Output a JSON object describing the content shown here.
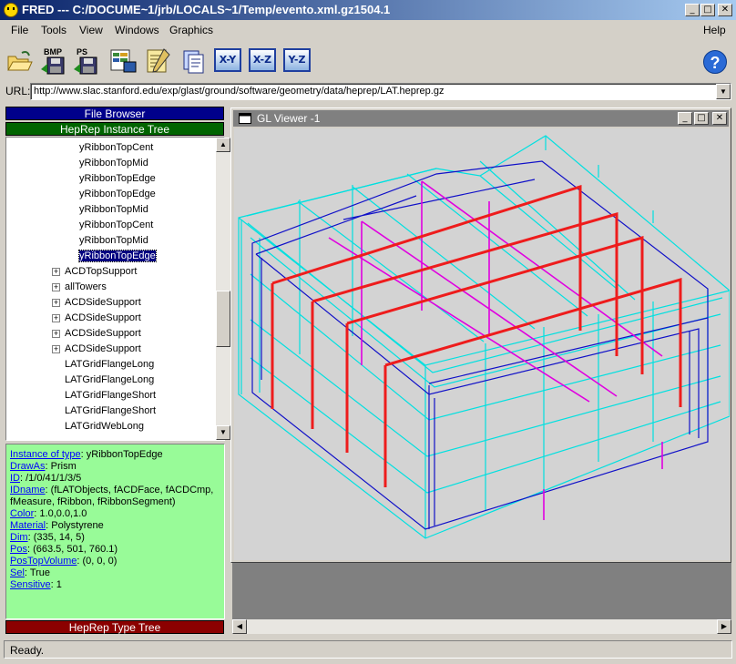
{
  "window": {
    "title": "FRED --- C:/DOCUME~1/jrb/LOCALS~1/Temp/evento.xml.gz1504.1"
  },
  "menu": {
    "file": "File",
    "tools": "Tools",
    "view": "View",
    "windows": "Windows",
    "graphics": "Graphics",
    "help": "Help"
  },
  "toolbar": {
    "bmp_label": "BMP",
    "ps_label": "PS",
    "xy_label": "X-Y",
    "xz_label": "X-Z",
    "yz_label": "Y-Z",
    "help_glyph": "?"
  },
  "url": {
    "label": "URL:",
    "value": "http://www.slac.stanford.edu/exp/glast/ground/software/geometry/data/heprep/LAT.heprep.gz"
  },
  "left": {
    "file_browser": "File Browser",
    "instance_tree": "HepRep Instance Tree",
    "type_tree": "HepRep Type Tree"
  },
  "tree": {
    "items": [
      {
        "label": "yRibbonTopCent"
      },
      {
        "label": "yRibbonTopMid"
      },
      {
        "label": "yRibbonTopEdge"
      },
      {
        "label": "yRibbonTopEdge"
      },
      {
        "label": "yRibbonTopMid"
      },
      {
        "label": "yRibbonTopCent"
      },
      {
        "label": "yRibbonTopMid"
      },
      {
        "label": "yRibbonTopEdge",
        "selected": true
      },
      {
        "label": "ACDTopSupport",
        "expandable": true
      },
      {
        "label": "allTowers",
        "expandable": true
      },
      {
        "label": "ACDSideSupport",
        "expandable": true
      },
      {
        "label": "ACDSideSupport",
        "expandable": true
      },
      {
        "label": "ACDSideSupport",
        "expandable": true
      },
      {
        "label": "ACDSideSupport",
        "expandable": true
      },
      {
        "label": "LATGridFlangeLong"
      },
      {
        "label": "LATGridFlangeLong"
      },
      {
        "label": "LATGridFlangeShort"
      },
      {
        "label": "LATGridFlangeShort"
      },
      {
        "label": "LATGridWebLong"
      }
    ]
  },
  "info": {
    "instance_key": "Instance of type",
    "instance_val": "yRibbonTopEdge",
    "drawas_key": "DrawAs",
    "drawas_val": "Prism",
    "id_key": "ID",
    "id_val": "/1/0/41/1/3/5",
    "idname_key": "IDname",
    "idname_val": "(fLATObjects, fACDFace, fACDCmp,",
    "idname_val2": "fMeasure, fRibbon, fRibbonSegment)",
    "color_key": "Color",
    "color_val": "1.0,0.0,1.0",
    "material_key": "Material",
    "material_val": "Polystyrene",
    "dim_key": "Dim",
    "dim_val": "(335, 14, 5)",
    "pos_key": "Pos",
    "pos_val": "(663.5, 501, 760.1)",
    "postop_key": "PosTopVolume",
    "postop_val": "(0, 0, 0)",
    "sel_key": "Sel",
    "sel_val": "True",
    "sens_key": "Sensitive",
    "sens_val": "1"
  },
  "gl": {
    "title": "GL Viewer -1"
  },
  "status": {
    "text": "Ready."
  },
  "colors": {
    "title_start": "#0a246a",
    "file_browser": "#00008b",
    "instance_tree": "#006400",
    "type_tree": "#8b0000",
    "info_bg": "#98fb98"
  }
}
